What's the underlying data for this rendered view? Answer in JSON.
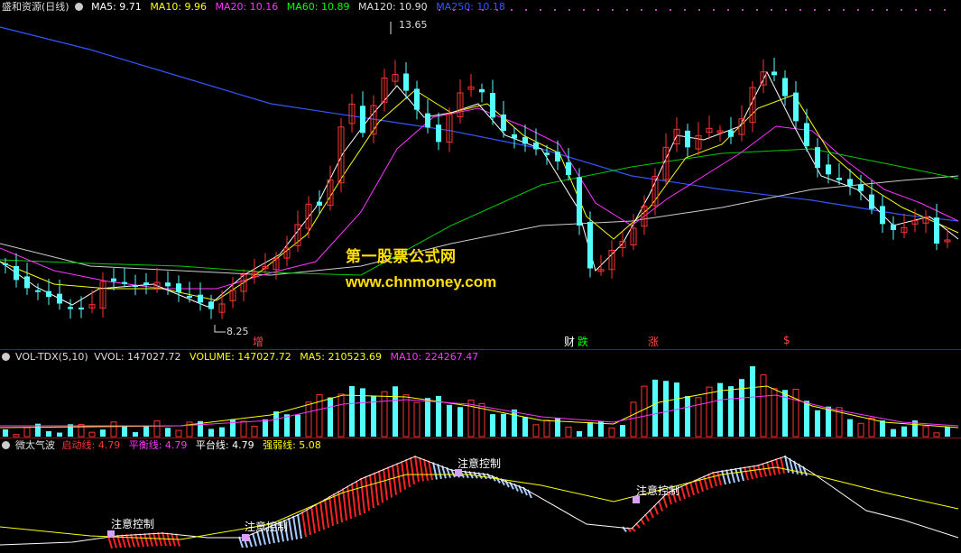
{
  "main": {
    "title": "盛和资源(日线)",
    "ma_labels": [
      {
        "text": "MA5: 9.71",
        "color": "#ffffff"
      },
      {
        "text": "MA10: 9.96",
        "color": "#ffff00"
      },
      {
        "text": "MA20: 10.16",
        "color": "#ff33ff"
      },
      {
        "text": "MA60: 10.89",
        "color": "#00ff00"
      },
      {
        "text": "MA120: 10.90",
        "color": "#dddddd"
      },
      {
        "text": "MA250: 10.18",
        "color": "#3355ff"
      }
    ],
    "high_label": "13.65",
    "low_label": "8.25",
    "watermark_cn": "第一股票公式网",
    "watermark_url": "www.chnmoney.com",
    "events": [
      {
        "text": "增",
        "color": "#ff4444"
      },
      {
        "text": "财",
        "color": "#ffffff"
      },
      {
        "text": "跌",
        "color": "#00ff00"
      },
      {
        "text": "涨",
        "color": "#ff4444"
      },
      {
        "text": "$",
        "color": "#ff4444"
      }
    ]
  },
  "volume": {
    "title": "VOL-TDX(5,10)",
    "labels": [
      {
        "text": "VVOL: 147027.72",
        "color": "#dddddd"
      },
      {
        "text": "VOLUME: 147027.72",
        "color": "#ffff00"
      },
      {
        "text": "MA5: 210523.69",
        "color": "#ffff00"
      },
      {
        "text": "MA10: 224267.47",
        "color": "#ff33ff"
      }
    ]
  },
  "indicator": {
    "title": "微太气波",
    "labels": [
      {
        "text": "启动线: 4.79",
        "color": "#ff3333"
      },
      {
        "text": "平衡线: 4.79",
        "color": "#ff33ff"
      },
      {
        "text": "平台线: 4.79",
        "color": "#ffffff"
      },
      {
        "text": "强弱线: 5.08",
        "color": "#ffff00"
      }
    ],
    "control_label": "注意控制"
  },
  "colors": {
    "up": "#ff3232",
    "down": "#54ffff",
    "ma250": "#3355ff",
    "ma60": "#00cc00",
    "ma20": "#ff33ff",
    "ma10": "#ffff00",
    "ma5": "#ffffff"
  }
}
